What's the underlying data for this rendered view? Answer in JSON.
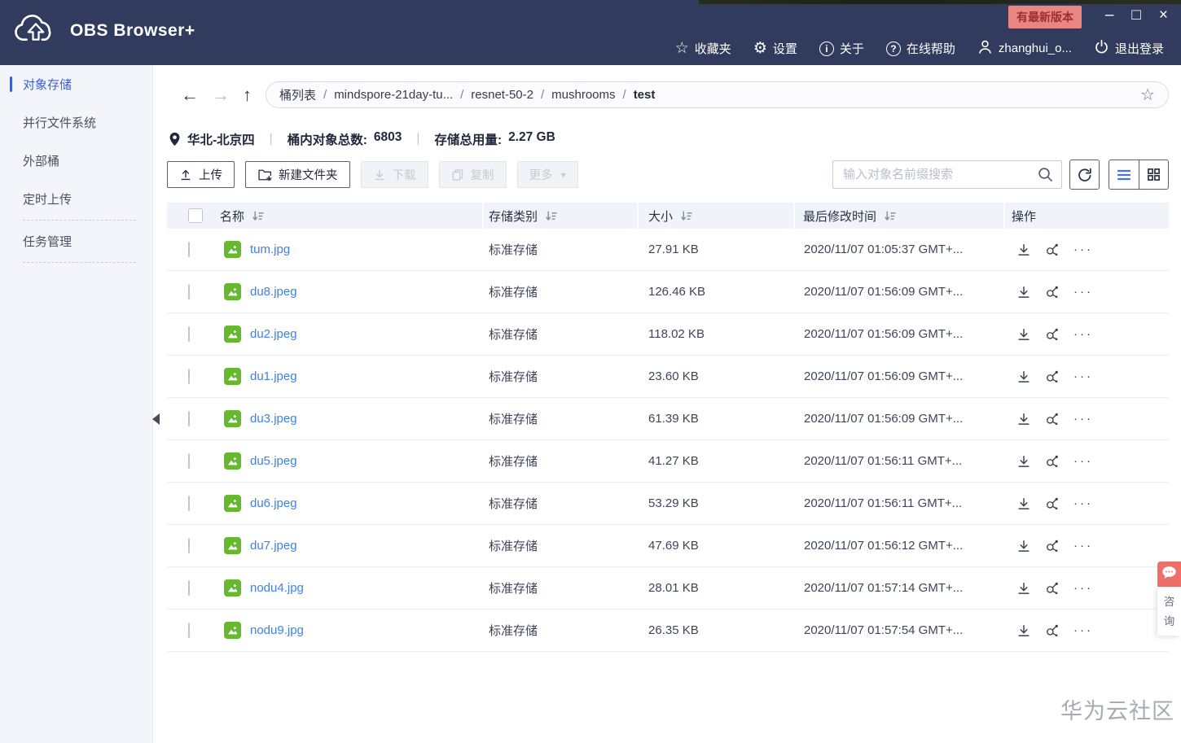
{
  "titlebar": {
    "app_name": "OBS Browser+",
    "update_badge": "有最新版本",
    "menu": [
      {
        "label": "收藏夹"
      },
      {
        "label": "设置"
      },
      {
        "label": "关于"
      },
      {
        "label": "在线帮助"
      },
      {
        "label": "zhanghui_o..."
      },
      {
        "label": "退出登录"
      }
    ]
  },
  "icons": {
    "star": "☆",
    "gear": "⚙",
    "info_letter": "i",
    "question_mark": "?",
    "minimize": "–",
    "maximize": "□",
    "close": "×",
    "back_arrow": "←",
    "forward_arrow": "→",
    "up_arrow": "↑",
    "favorite_star": "☆",
    "caret_down": "▾",
    "more_dots": "···",
    "pipe": "|"
  },
  "sidebar": {
    "items": [
      {
        "label": "对象存储",
        "active": true
      },
      {
        "label": "并行文件系统",
        "active": false
      },
      {
        "label": "外部桶",
        "active": false
      },
      {
        "label": "定时上传",
        "active": false
      },
      {
        "label": "任务管理",
        "active": false
      }
    ]
  },
  "breadcrumb": {
    "segments": [
      "桶列表",
      "mindspore-21day-tu...",
      "resnet-50-2",
      "mushrooms",
      "test"
    ],
    "separator": "/"
  },
  "bucket_info": {
    "region": "华北-北京四",
    "object_count_label": "桶内对象总数:",
    "object_count": "6803",
    "usage_label": "存储总用量:",
    "usage": "2.27 GB"
  },
  "toolbar": {
    "upload": "上传",
    "new_folder": "新建文件夹",
    "download": "下载",
    "copy": "复制",
    "more": "更多",
    "search_placeholder": "输入对象名前缀搜索"
  },
  "table": {
    "headers": {
      "name": "名称",
      "storage_class": "存储类别",
      "size": "大小",
      "modified": "最后修改时间",
      "operations": "操作"
    },
    "rows": [
      {
        "name": "tum.jpg",
        "storage_class": "标准存储",
        "size": "27.91 KB",
        "modified": "2020/11/07 01:05:37 GMT+..."
      },
      {
        "name": "du8.jpeg",
        "storage_class": "标准存储",
        "size": "126.46 KB",
        "modified": "2020/11/07 01:56:09 GMT+..."
      },
      {
        "name": "du2.jpeg",
        "storage_class": "标准存储",
        "size": "118.02 KB",
        "modified": "2020/11/07 01:56:09 GMT+..."
      },
      {
        "name": "du1.jpeg",
        "storage_class": "标准存储",
        "size": "23.60 KB",
        "modified": "2020/11/07 01:56:09 GMT+..."
      },
      {
        "name": "du3.jpeg",
        "storage_class": "标准存储",
        "size": "61.39 KB",
        "modified": "2020/11/07 01:56:09 GMT+..."
      },
      {
        "name": "du5.jpeg",
        "storage_class": "标准存储",
        "size": "41.27 KB",
        "modified": "2020/11/07 01:56:11 GMT+..."
      },
      {
        "name": "du6.jpeg",
        "storage_class": "标准存储",
        "size": "53.29 KB",
        "modified": "2020/11/07 01:56:11 GMT+..."
      },
      {
        "name": "du7.jpeg",
        "storage_class": "标准存储",
        "size": "47.69 KB",
        "modified": "2020/11/07 01:56:12 GMT+..."
      },
      {
        "name": "nodu4.jpg",
        "storage_class": "标准存储",
        "size": "28.01 KB",
        "modified": "2020/11/07 01:57:14 GMT+..."
      },
      {
        "name": "nodu9.jpg",
        "storage_class": "标准存储",
        "size": "26.35 KB",
        "modified": "2020/11/07 01:57:54 GMT+..."
      }
    ]
  },
  "consult_widget": {
    "label_char1": "咨",
    "label_char2": "询"
  },
  "watermark": "华为云社区",
  "colors": {
    "titlebar_bg": "#303b5e",
    "badge_bg": "#ea8681",
    "accent_blue": "#3a5dd9",
    "link_blue": "#3f82e8",
    "icon_green": "#66b82f",
    "table_header_bg": "#f1f3fb",
    "consult_red": "#ee6e68"
  }
}
